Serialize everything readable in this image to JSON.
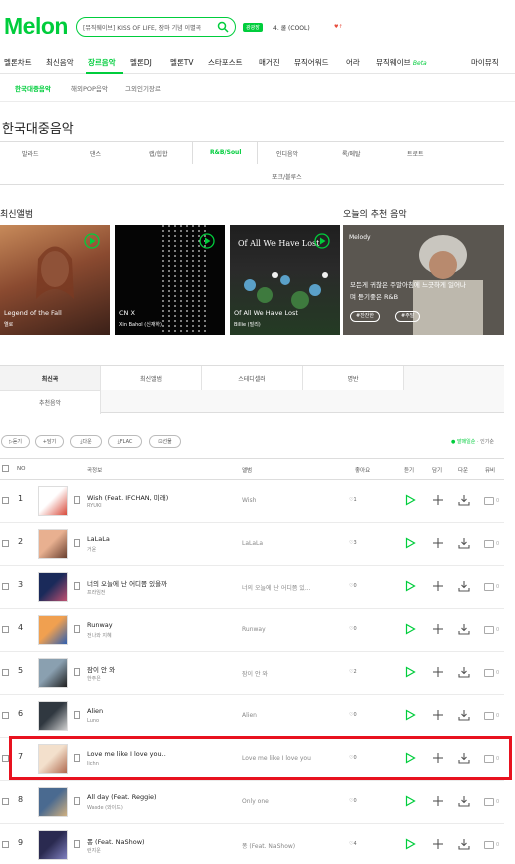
{
  "header": {
    "logo": "Melon",
    "search_text": "[뮤직웨이브] KISS OF LIFE, 장마 기념 이별곡",
    "badge": "광광장",
    "rank_text": "4. 쿨 (COOL)",
    "dot": "♥↑"
  },
  "gnb": [
    "멜론차트",
    "최신음악",
    "장르음악",
    "멜론DJ",
    "멜론TV",
    "스타포스트",
    "매거진",
    "뮤직어워드",
    "어라",
    "뮤직웨이브",
    "마이뮤직"
  ],
  "gnb_beta": "Beta",
  "subnav": [
    "한국대중음악",
    "해외POP음악",
    "그외인기장르"
  ],
  "page_title": "한국대중음악",
  "genres": [
    "발라드",
    "댄스",
    "랩/힙합",
    "R&B/Soul",
    "인디음악",
    "록/메탈",
    "트로트",
    "포크/블루스"
  ],
  "new_album_title": "최신앨범",
  "albums": [
    {
      "title": "Legend of the Fall",
      "artist": "엘로"
    },
    {
      "title": "CN X",
      "artist": "Xin Bahol (신재하)"
    },
    {
      "title": "Of All We Have Lost",
      "artist": "Billie (빌리)"
    }
  ],
  "album_cover_text": "Of All We Have Lost",
  "rec_title": "오늘의 추천 음악",
  "rec": {
    "brand": "Melody",
    "text1": "모든게 귀찮은 주말아침에 느긋하게 일어나",
    "text2": "며 듣기좋은 R&B",
    "tag1": "#잔잔한",
    "tag2": "#주말"
  },
  "tabs": [
    "최신곡",
    "최신앨범",
    "스테디셀러",
    "명반",
    "추천음악"
  ],
  "actions": [
    "듣기",
    "담기",
    "다운",
    "FLAC",
    "선물"
  ],
  "sort": {
    "on": "● 발매일순",
    "off": "· 인기순"
  },
  "thead": {
    "no": "NO",
    "song": "곡정보",
    "album": "앨범",
    "like": "좋아요",
    "listen": "듣기",
    "add": "담기",
    "down": "다운",
    "mv": "뮤비"
  },
  "songs": [
    {
      "no": "1",
      "title": "Wish (Feat. IFCHAN, 미래)",
      "artist": "RYUKI",
      "album": "Wish",
      "likes": "1"
    },
    {
      "no": "2",
      "title": "LaLaLa",
      "artist": "거윤",
      "album": "LaLaLa",
      "likes": "3"
    },
    {
      "no": "3",
      "title": "너의 오늘에 난 어디쯤 있을까",
      "artist": "프라임전",
      "album": "너의 오늘에 난 어디쯤 있...",
      "likes": "0"
    },
    {
      "no": "4",
      "title": "Runway",
      "artist": "전나와 지혜",
      "album": "Runway",
      "likes": "0"
    },
    {
      "no": "5",
      "title": "잠이 안 와",
      "artist": "한주은",
      "album": "잠이 안 와",
      "likes": "2"
    },
    {
      "no": "6",
      "title": "Alien",
      "artist": "Luno",
      "album": "Alien",
      "likes": "0"
    },
    {
      "no": "7",
      "title": "Love me like I love you..",
      "artist": "lichn",
      "album": "Love me like I love you",
      "likes": "0"
    },
    {
      "no": "8",
      "title": "All day (Feat. Reggie)",
      "artist": "Wasde (와이드)",
      "album": "Only one",
      "likes": "0"
    },
    {
      "no": "9",
      "title": "퐁 (Feat. NaShow)",
      "artist": "런지운",
      "album": "퐁 (Feat. NaShow)",
      "likes": "4"
    }
  ],
  "mv_count": "0",
  "colors": {
    "accent": "#00cd3c",
    "highlight": "#e8121f"
  }
}
